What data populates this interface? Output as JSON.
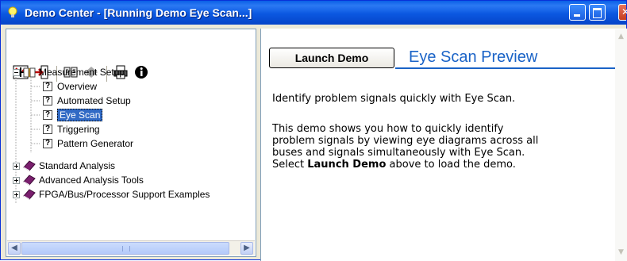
{
  "window": {
    "title": "Demo Center - [Running Demo Eye Scan...]",
    "accent": "#0a5fe6",
    "close_color": "#c53d1d"
  },
  "toolbar": {
    "icons": [
      "grid-expand-icon",
      "exit-icon",
      "open-book-icon",
      "bookmark-icon",
      "print-icon",
      "info-icon"
    ]
  },
  "tree": {
    "root": {
      "label": "Measurement Setup",
      "expanded": true,
      "children": [
        "Overview",
        "Automated Setup",
        "Eye Scan",
        "Triggering",
        "Pattern Generator"
      ],
      "selected": "Eye Scan"
    },
    "collapsed": [
      "Standard Analysis",
      "Advanced Analysis Tools",
      "FPGA/Bus/Processor Support Examples"
    ]
  },
  "main": {
    "launch_button": "Launch Demo",
    "preview_title": "Eye Scan Preview",
    "intro": "Identify problem signals quickly with Eye Scan.",
    "description": {
      "line1": "This demo shows you how to quickly identify",
      "line2": "problem signals by viewing eye diagrams across all",
      "line3": "buses and signals simultaneously with Eye Scan.",
      "line4_prefix": "Select ",
      "line4_bold": "Launch Demo",
      "line4_suffix": " above to load the demo."
    }
  }
}
